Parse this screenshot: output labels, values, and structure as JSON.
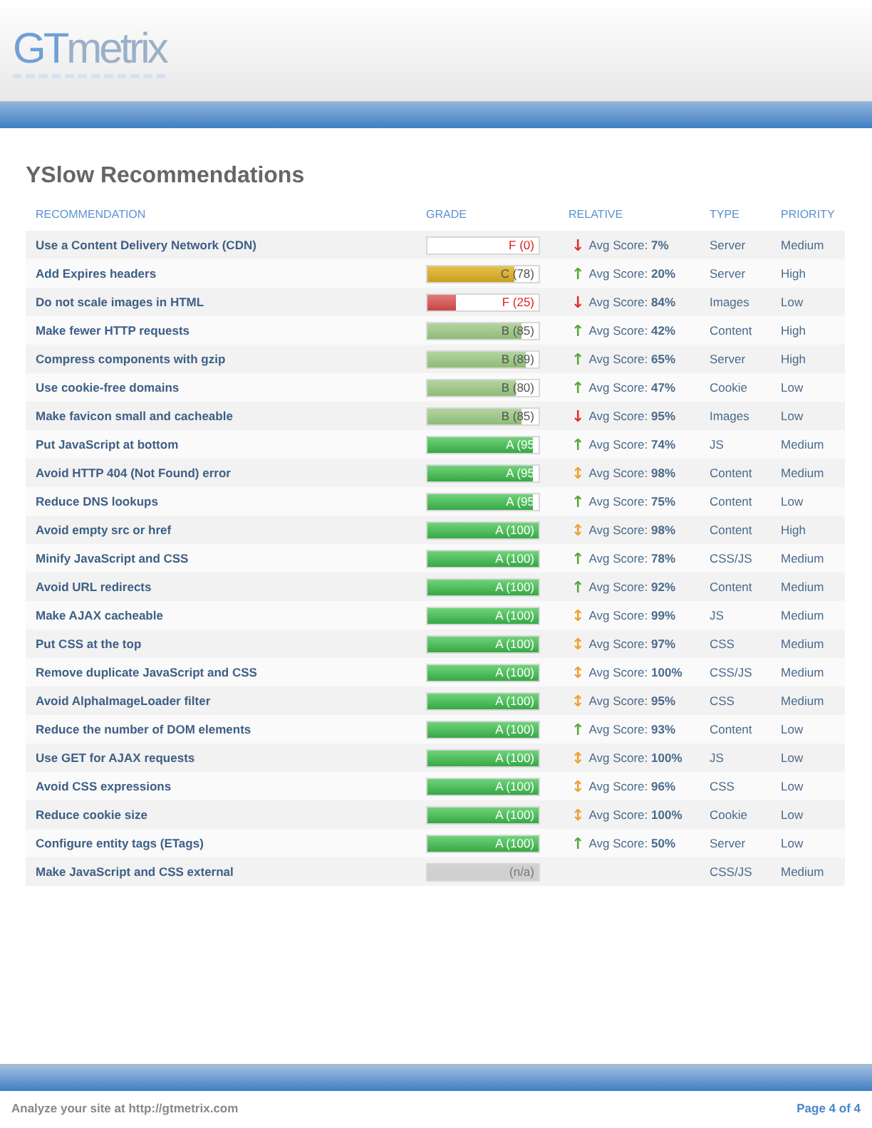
{
  "logo": {
    "lead": "GT",
    "rest": "metrix"
  },
  "title": "YSlow Recommendations",
  "table": {
    "columns": [
      "RECOMMENDATION",
      "GRADE",
      "RELATIVE",
      "TYPE",
      "PRIORITY"
    ],
    "rows": [
      {
        "recommendation": "Use a Content Delivery Network (CDN)",
        "grade": "F (0)",
        "kind": "f",
        "arrow": {
          "glyph": "↓",
          "color": "#e03030"
        },
        "relative": "Avg Score: **7%**",
        "type": "Server",
        "priority": "Medium"
      },
      {
        "recommendation": "Add Expires headers",
        "grade": "C (78)",
        "kind": "c",
        "level": 0.78,
        "arrow": {
          "glyph": "↑",
          "color": "#5aa83a"
        },
        "relative": "Avg Score: **20%**",
        "type": "Server",
        "priority": "High"
      },
      {
        "recommendation": "Do not scale images in HTML",
        "grade": "F (25)",
        "kind": "f",
        "level": 0.25,
        "arrow": {
          "glyph": "↓",
          "color": "#e03030"
        },
        "relative": "Avg Score: **84%**",
        "type": "Images",
        "priority": "Low"
      },
      {
        "recommendation": "Make fewer HTTP requests",
        "grade": "B (85)",
        "kind": "b",
        "level": 0.85,
        "arrow": {
          "glyph": "↑",
          "color": "#5aa83a"
        },
        "relative": "Avg Score: **42%**",
        "type": "Content",
        "priority": "High"
      },
      {
        "recommendation": "Compress components with gzip",
        "grade": "B (89)",
        "kind": "b",
        "level": 0.89,
        "arrow": {
          "glyph": "↑",
          "color": "#5aa83a"
        },
        "relative": "Avg Score: **65%**",
        "type": "Server",
        "priority": "High"
      },
      {
        "recommendation": "Use cookie-free domains",
        "grade": "B (80)",
        "kind": "b",
        "level": 0.8,
        "arrow": {
          "glyph": "↑",
          "color": "#5aa83a"
        },
        "relative": "Avg Score: **47%**",
        "type": "Cookie",
        "priority": "Low"
      },
      {
        "recommendation": "Make favicon small and cacheable",
        "grade": "B (85)",
        "kind": "b",
        "level": 0.85,
        "arrow": {
          "glyph": "↓",
          "color": "#e03030"
        },
        "relative": "Avg Score: **95%**",
        "type": "Images",
        "priority": "Low"
      },
      {
        "recommendation": "Put JavaScript at bottom",
        "grade": "A (95",
        "kind": "a",
        "level": 0.95,
        "arrow": {
          "glyph": "↑",
          "color": "#5aa83a"
        },
        "relative": "Avg Score: **74%**",
        "type": "JS",
        "priority": "Medium"
      },
      {
        "recommendation": "Avoid HTTP 404 (Not Found) error",
        "grade": "A (95",
        "kind": "a",
        "level": 0.95,
        "arrow": {
          "glyph": "↕",
          "color": "#f0a030"
        },
        "relative": "Avg Score: **98%**",
        "type": "Content",
        "priority": "Medium"
      },
      {
        "recommendation": "Reduce DNS lookups",
        "grade": "A (95",
        "kind": "a",
        "level": 0.95,
        "arrow": {
          "glyph": "↑",
          "color": "#5aa83a"
        },
        "relative": "Avg Score: **75%**",
        "type": "Content",
        "priority": "Low"
      },
      {
        "recommendation": "Avoid empty src or href",
        "grade": "A (100)",
        "kind": "a",
        "level": 1,
        "arrow": {
          "glyph": "↕",
          "color": "#f0a030"
        },
        "relative": "Avg Score: **98%**",
        "type": "Content",
        "priority": "High"
      },
      {
        "recommendation": "Minify JavaScript and CSS",
        "grade": "A (100)",
        "kind": "a",
        "level": 1,
        "arrow": {
          "glyph": "↑",
          "color": "#5aa83a"
        },
        "relative": "Avg Score: **78%**",
        "type": "CSS/JS",
        "priority": "Medium"
      },
      {
        "recommendation": "Avoid URL redirects",
        "grade": "A (100)",
        "kind": "a",
        "level": 1,
        "arrow": {
          "glyph": "↑",
          "color": "#5aa83a"
        },
        "relative": "Avg Score: **92%**",
        "type": "Content",
        "priority": "Medium"
      },
      {
        "recommendation": "Make AJAX cacheable",
        "grade": "A (100)",
        "kind": "a",
        "level": 1,
        "arrow": {
          "glyph": "↕",
          "color": "#f0a030"
        },
        "relative": "Avg Score: **99%**",
        "type": "JS",
        "priority": "Medium"
      },
      {
        "recommendation": "Put CSS at the top",
        "grade": "A (100)",
        "kind": "a",
        "level": 1,
        "arrow": {
          "glyph": "↕",
          "color": "#f0a030"
        },
        "relative": "Avg Score: **97%**",
        "type": "CSS",
        "priority": "Medium"
      },
      {
        "recommendation": "Remove duplicate JavaScript and CSS",
        "grade": "A (100)",
        "kind": "a",
        "level": 1,
        "arrow": {
          "glyph": "↕",
          "color": "#f0a030"
        },
        "relative": "Avg Score: **100%**",
        "type": "CSS/JS",
        "priority": "Medium"
      },
      {
        "recommendation": "Avoid AlphaImageLoader filter",
        "grade": "A (100)",
        "kind": "a",
        "level": 1,
        "arrow": {
          "glyph": "↕",
          "color": "#f0a030"
        },
        "relative": "Avg Score: **95%**",
        "type": "CSS",
        "priority": "Medium"
      },
      {
        "recommendation": "Reduce the number of DOM elements",
        "grade": "A (100)",
        "kind": "a",
        "level": 1,
        "arrow": {
          "glyph": "↑",
          "color": "#5aa83a"
        },
        "relative": "Avg Score: **93%**",
        "type": "Content",
        "priority": "Low"
      },
      {
        "recommendation": "Use GET for AJAX requests",
        "grade": "A (100)",
        "kind": "a",
        "level": 1,
        "arrow": {
          "glyph": "↕",
          "color": "#f0a030"
        },
        "relative": "Avg Score: **100%**",
        "type": "JS",
        "priority": "Low"
      },
      {
        "recommendation": "Avoid CSS expressions",
        "grade": "A (100)",
        "kind": "a",
        "level": 1,
        "arrow": {
          "glyph": "↕",
          "color": "#f0a030"
        },
        "relative": "Avg Score: **96%**",
        "type": "CSS",
        "priority": "Low"
      },
      {
        "recommendation": "Reduce cookie size",
        "grade": "A (100)",
        "kind": "a",
        "level": 1,
        "arrow": {
          "glyph": "↕",
          "color": "#f0a030"
        },
        "relative": "Avg Score: **100%**",
        "type": "Cookie",
        "priority": "Low"
      },
      {
        "recommendation": "Configure entity tags (ETags)",
        "grade": "A (100)",
        "kind": "a",
        "level": 1,
        "arrow": {
          "glyph": "↑",
          "color": "#5aa83a"
        },
        "relative": "Avg Score: **50%**",
        "type": "Server",
        "priority": "Low"
      },
      {
        "recommendation": "Make JavaScript and CSS external",
        "grade": "(n/a)",
        "kind": "na",
        "level": 1,
        "type": "CSS/JS",
        "priority": "Medium"
      }
    ]
  },
  "footer": {
    "note": "Analyze your site at http://gtmetrix.com",
    "page": "Page 4 of 4"
  }
}
